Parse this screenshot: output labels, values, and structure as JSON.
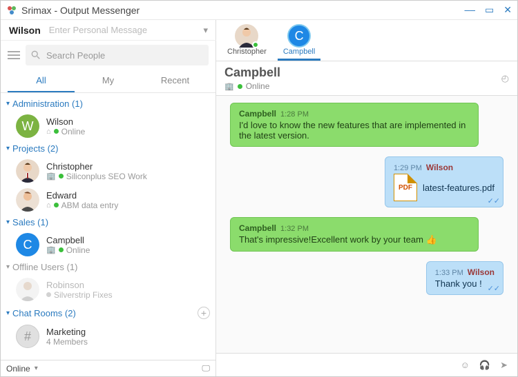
{
  "window": {
    "title": "Srimax - Output Messenger"
  },
  "user": {
    "name": "Wilson",
    "personal_msg_placeholder": "Enter Personal Message"
  },
  "search": {
    "placeholder": "Search People"
  },
  "tabs": {
    "all": "All",
    "my": "My",
    "recent": "Recent"
  },
  "groups": {
    "administration": {
      "label": "Administration (1)"
    },
    "projects": {
      "label": "Projects (2)"
    },
    "sales": {
      "label": "Sales (1)"
    },
    "offline": {
      "label": "Offline Users (1)"
    },
    "chatrooms": {
      "label": "Chat Rooms (2)"
    }
  },
  "people": {
    "wilson": {
      "name": "Wilson",
      "status": "Online"
    },
    "christopher": {
      "name": "Christopher",
      "status": "Siliconplus SEO Work"
    },
    "edward": {
      "name": "Edward",
      "status": "ABM data entry"
    },
    "campbell": {
      "name": "Campbell",
      "status": "Online",
      "initial": "C"
    },
    "robinson": {
      "name": "Robinson",
      "status": "Silverstrip Fixes"
    },
    "marketing": {
      "name": "Marketing",
      "status": "4 Members"
    }
  },
  "statusbar": {
    "label": "Online"
  },
  "chat_tabs": {
    "t1": "Christopher",
    "t2": "Campbell"
  },
  "chatheader": {
    "name": "Campbell",
    "status": "Online"
  },
  "messages": {
    "m1": {
      "sender": "Campbell",
      "time": "1:28 PM",
      "text": "I'd love to know the new features that are implemented in the latest version."
    },
    "m2": {
      "sender": "Wilson",
      "time": "1:29 PM",
      "file": "latest-features.pdf"
    },
    "m3": {
      "sender": "Campbell",
      "time": "1:32 PM",
      "text": "That's impressive!Excellent work by your team 👍"
    },
    "m4": {
      "sender": "Wilson",
      "time": "1:33 PM",
      "text": "Thank you !"
    }
  }
}
